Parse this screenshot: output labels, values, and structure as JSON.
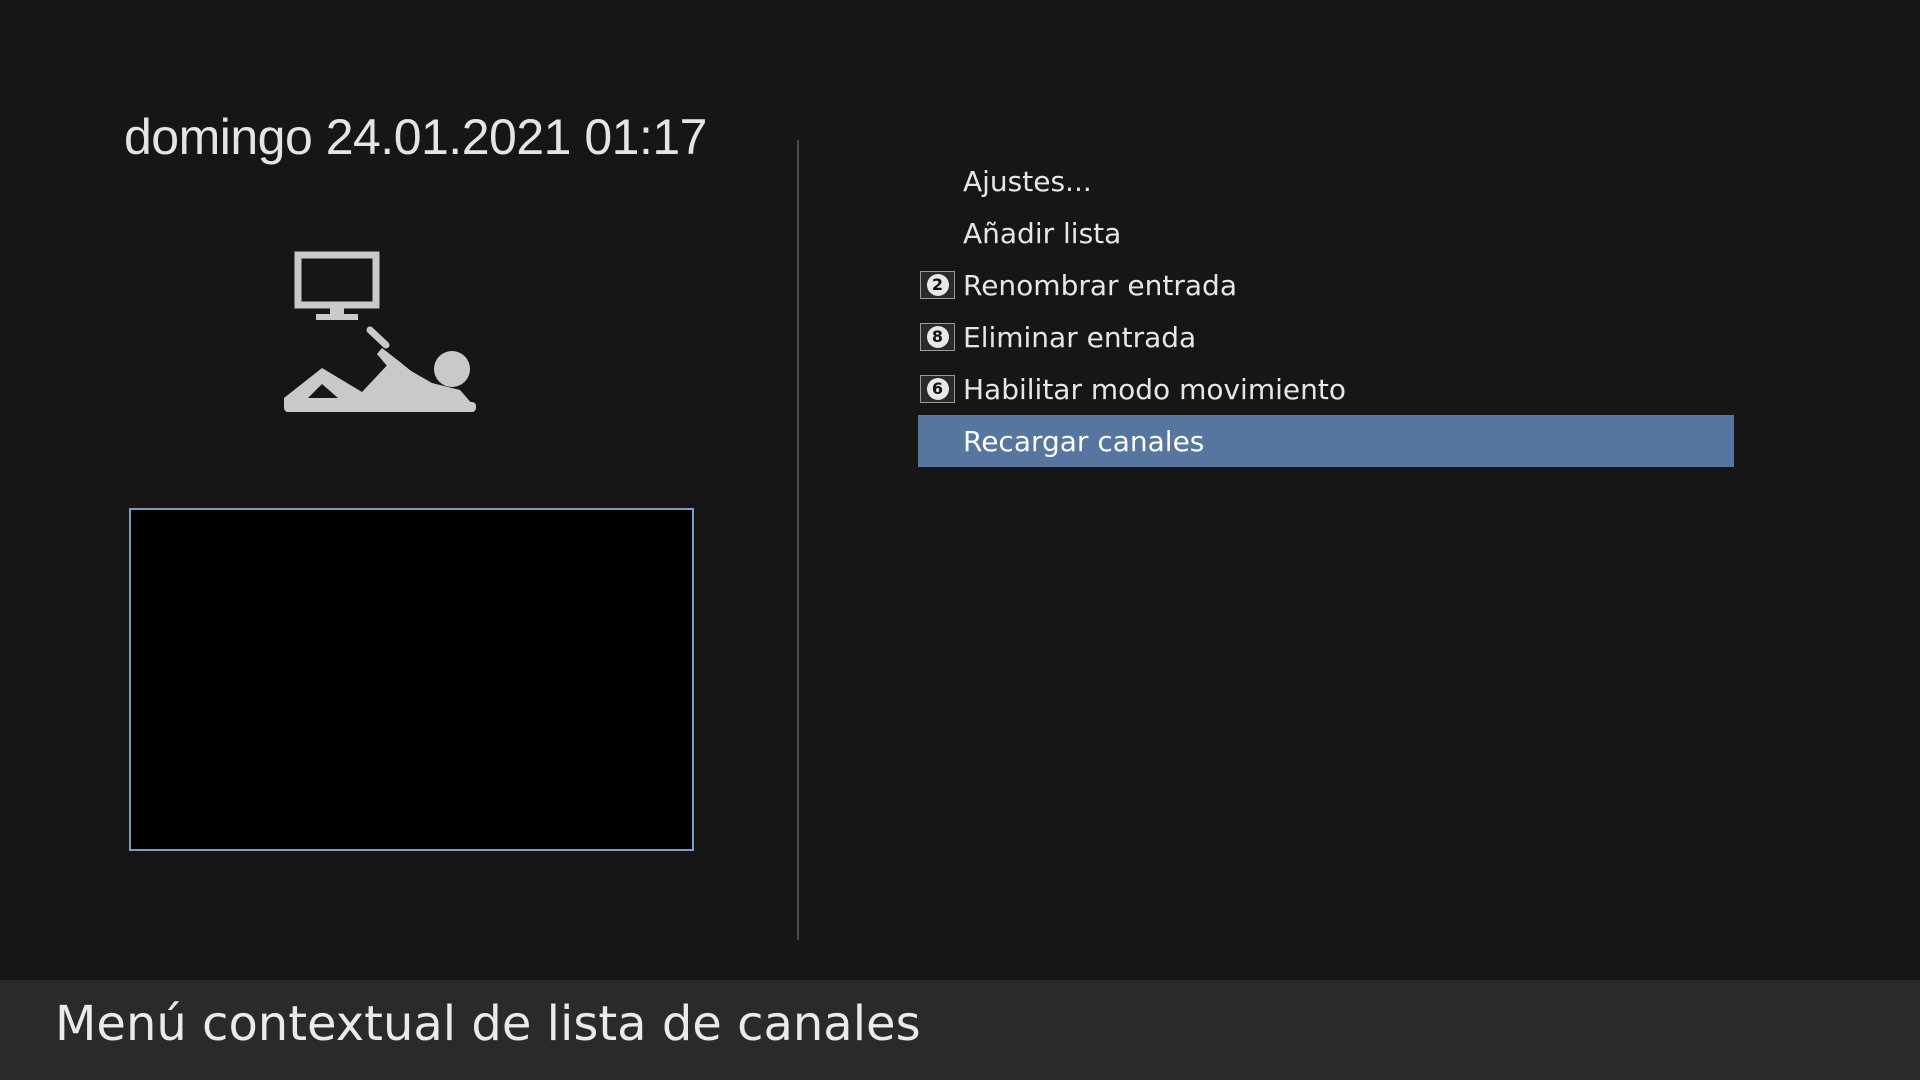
{
  "header": {
    "datetime": "domingo 24.01.2021 01:17"
  },
  "illustration": {
    "icon": "person-lying-watching-tv-icon"
  },
  "context_menu": {
    "items": [
      {
        "label": "Ajustes...",
        "key": "",
        "selected": false
      },
      {
        "label": "Añadir lista",
        "key": "",
        "selected": false
      },
      {
        "label": "Renombrar entrada",
        "key": "2",
        "selected": false
      },
      {
        "label": "Eliminar entrada",
        "key": "8",
        "selected": false
      },
      {
        "label": "Habilitar modo movimiento",
        "key": "6",
        "selected": false
      },
      {
        "label": "Recargar canales",
        "key": "",
        "selected": true
      }
    ]
  },
  "footer": {
    "title": "Menú contextual de lista de canales"
  },
  "colors": {
    "background": "#161616",
    "selection": "#5676a0",
    "preview_border": "#7a9cc4",
    "footer_bar": "#2a2a2a"
  }
}
